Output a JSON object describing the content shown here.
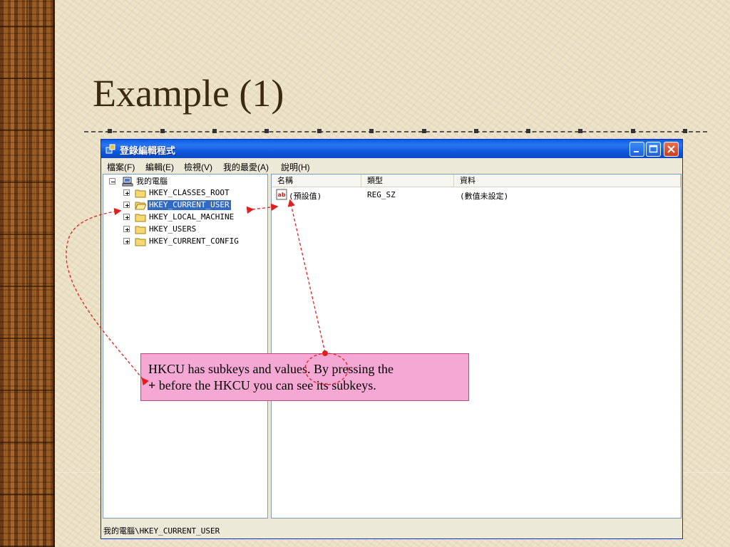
{
  "slide": {
    "title": "Example (1)"
  },
  "window": {
    "title": "登錄編輯程式",
    "menu": [
      {
        "label": "檔案(F)"
      },
      {
        "label": "編輯(E)"
      },
      {
        "label": "檢視(V)"
      },
      {
        "label": "我的最愛(A)"
      },
      {
        "label": "說明(H)"
      }
    ],
    "tree": {
      "root": "我的電腦",
      "keys": [
        {
          "label": "HKEY_CLASSES_ROOT",
          "selected": false
        },
        {
          "label": "HKEY_CURRENT_USER",
          "selected": true
        },
        {
          "label": "HKEY_LOCAL_MACHINE",
          "selected": false
        },
        {
          "label": "HKEY_USERS",
          "selected": false
        },
        {
          "label": "HKEY_CURRENT_CONFIG",
          "selected": false
        }
      ]
    },
    "list": {
      "columns": [
        "名稱",
        "類型",
        "資料"
      ],
      "rows": [
        {
          "name": "(預設值)",
          "type": "REG_SZ",
          "data": "(數值未設定)",
          "icon": "string-value-icon"
        }
      ]
    },
    "status": "我的電腦\\HKEY_CURRENT_USER"
  },
  "callout": {
    "text_line1": "HKCU has subkeys and values. By pressing the",
    "plus": "+",
    "text_line2": " before the HKCU you can see its subkeys."
  },
  "colors": {
    "selection": "#316ac5",
    "callout_bg": "#f5a8d4",
    "titlebar": "#0a5ce8",
    "arrow": "#e02020"
  }
}
